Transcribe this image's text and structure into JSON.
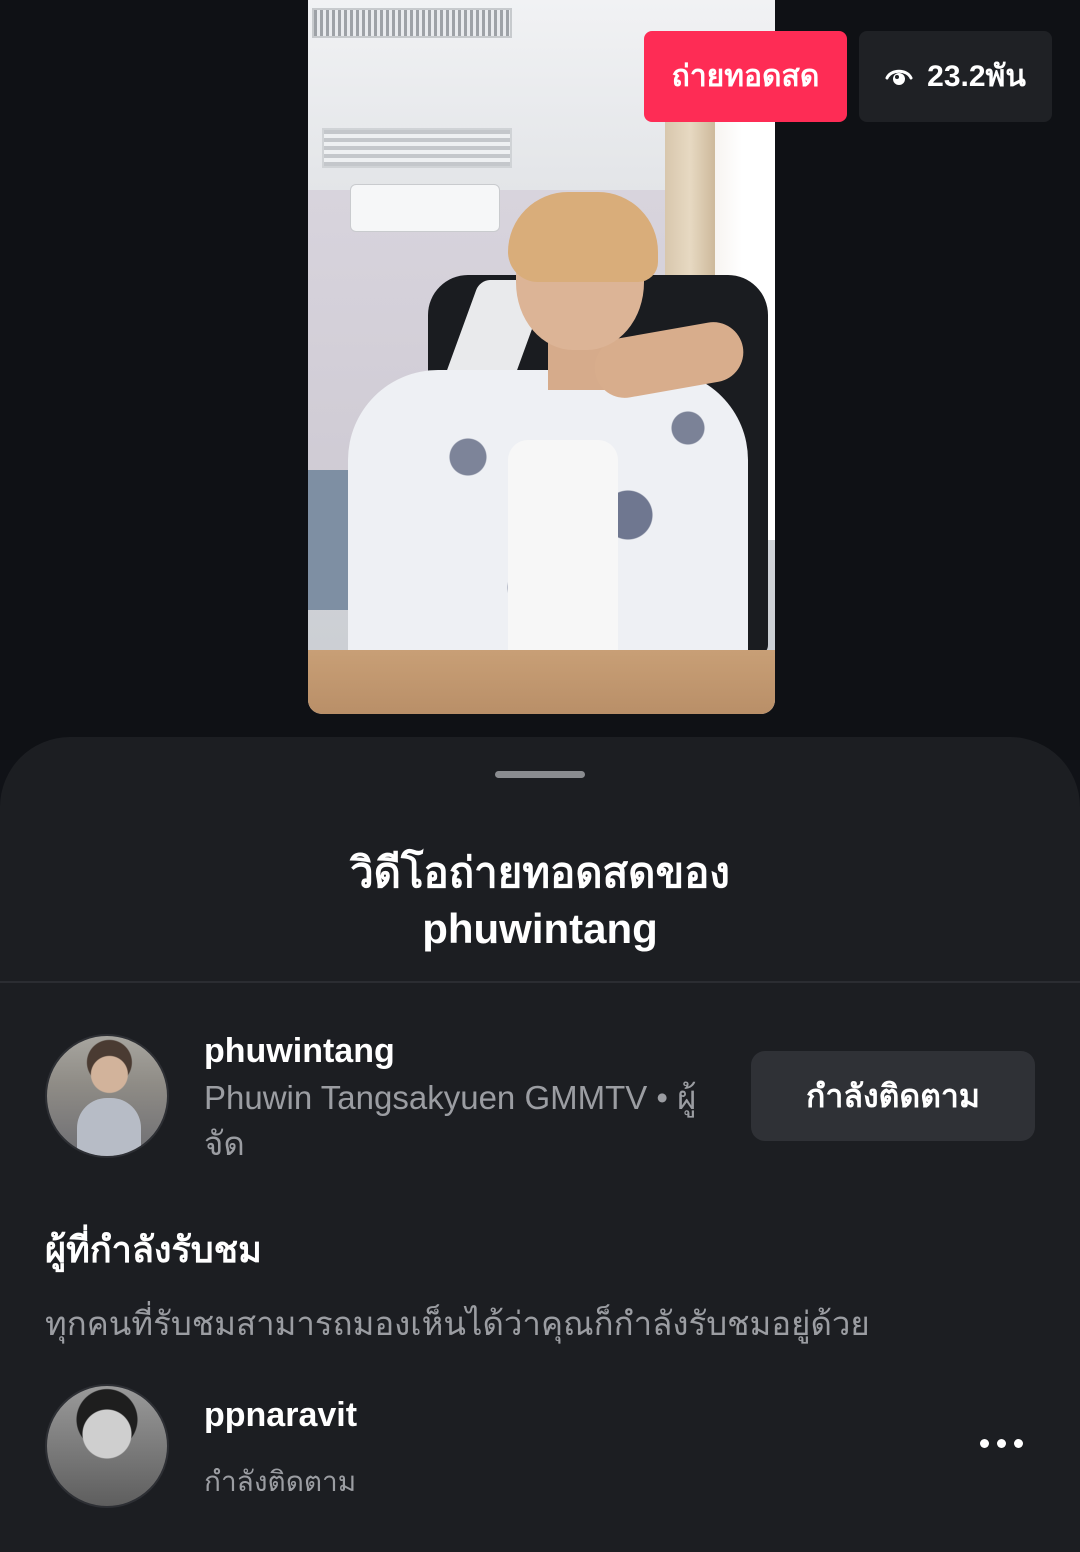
{
  "live": {
    "badge_label": "ถ่ายทอดสด",
    "viewer_count": "23.2พัน",
    "eye_icon": "eye-icon"
  },
  "sheet": {
    "title_line1": "วิดีโอถ่ายทอดสดของ",
    "title_line2": "phuwintang"
  },
  "host": {
    "username": "phuwintang",
    "subtitle": "Phuwin Tangsakyuen GMMTV • ผู้จัด",
    "follow_label": "กำลังติดตาม"
  },
  "viewers": {
    "heading": "ผู้ที่กำลังรับชม",
    "note": "ทุกคนที่รับชมสามารถมองเห็นได้ว่าคุณก็กำลังรับชมอยู่ด้วย",
    "items": [
      {
        "username": "ppnaravit",
        "status": "กำลังติดตาม"
      }
    ]
  },
  "colors": {
    "live_badge": "#fe2c55",
    "sheet_bg": "#1c1e22",
    "page_bg": "#0f1115",
    "secondary_text": "#9b9da2"
  }
}
